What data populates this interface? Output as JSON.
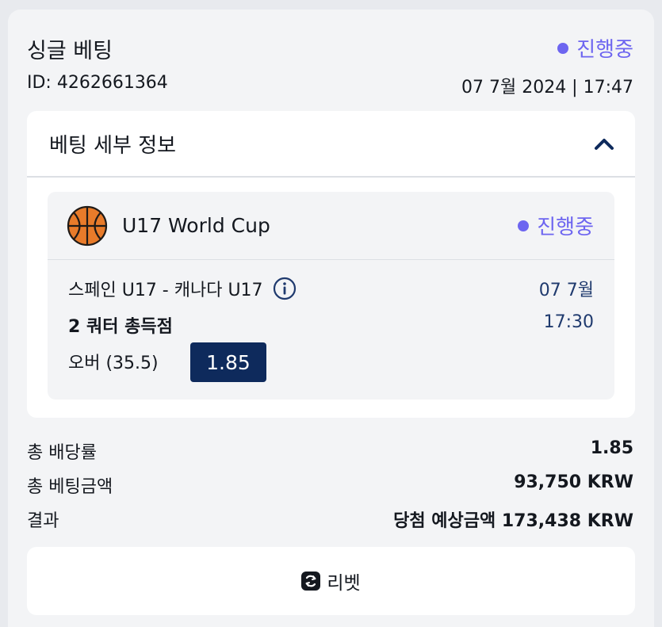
{
  "bet": {
    "title": "싱글 베팅",
    "status": "진행중",
    "id_label": "ID: 4262661364",
    "datetime": "07 7월 2024 | 17:47"
  },
  "details": {
    "title": "베팅 세부 정보",
    "event": {
      "league": "U17 World Cup",
      "status": "진행중",
      "match": "스페인 U17 - 캐나다 U17",
      "market": "2 쿼터 총득점",
      "selection": "오버 (35.5)",
      "odds": "1.85",
      "date": "07 7월",
      "time": "17:30"
    }
  },
  "summary": {
    "total_odds_label": "총 배당률",
    "total_odds_value": "1.85",
    "total_stake_label": "총 베팅금액",
    "total_stake_value": "93,750 KRW",
    "result_label": "결과",
    "result_value": "당첨 예상금액 173,438 KRW"
  },
  "actions": {
    "rebet_label": "리벳"
  },
  "colors": {
    "accent": "#6d65f0",
    "odds_bg": "#0e2a5c",
    "time_text": "#1f3a6e"
  },
  "icons": {
    "sport": "basketball-icon",
    "collapse": "chevron-up-icon",
    "info": "info-icon",
    "rebet": "refresh-icon"
  }
}
